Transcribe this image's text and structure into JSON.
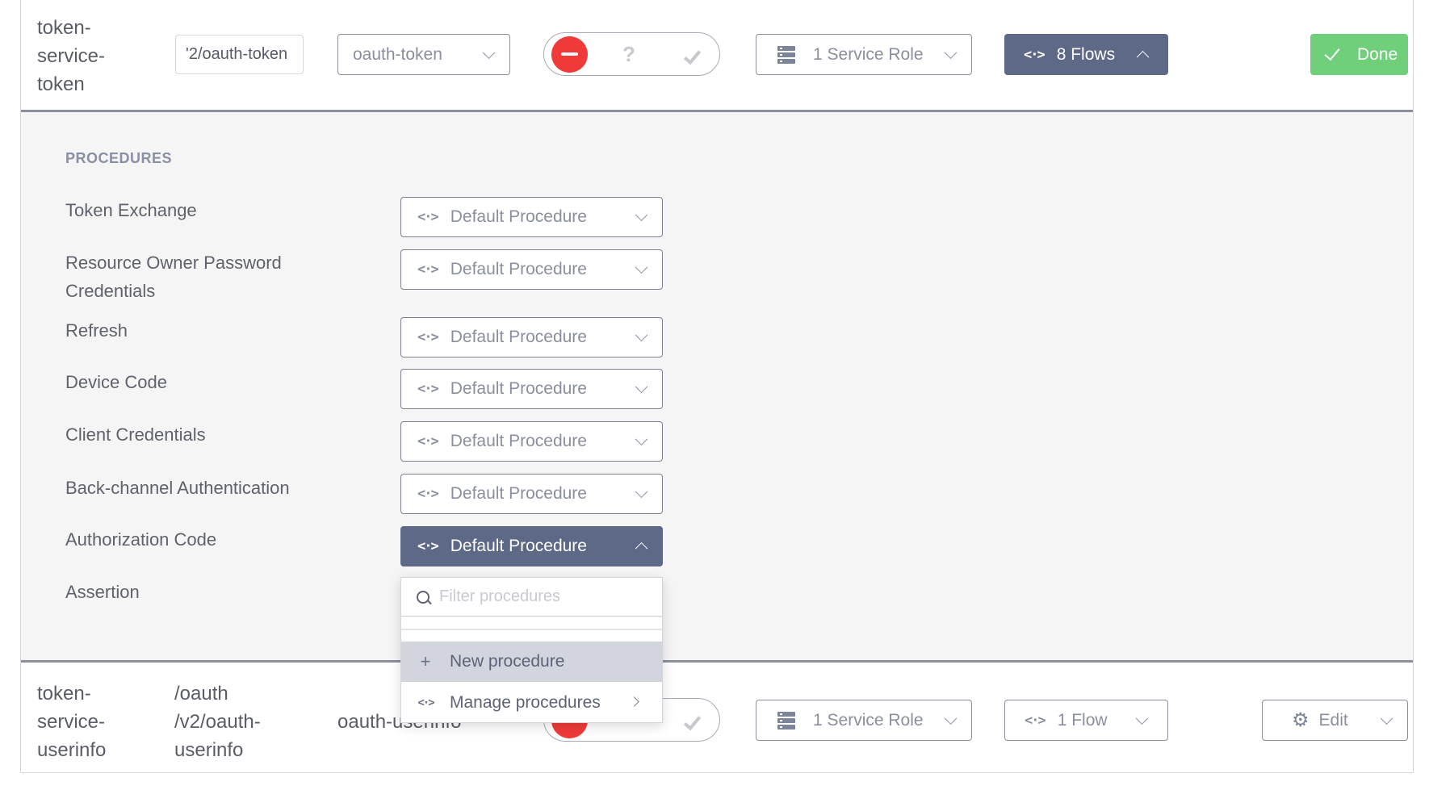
{
  "row1": {
    "name_lines": [
      "token-",
      "service-",
      "token"
    ],
    "path_value": "'2/oauth-token",
    "select_value": "oauth-token",
    "toggle": {
      "state": "deny",
      "options": [
        "deny",
        "unknown",
        "allow"
      ],
      "unknown_glyph": "?"
    },
    "service_role_label": "1 Service Role",
    "flows_label": "8 Flows",
    "flows_icon": "<·>",
    "done_label": "Done",
    "colors": {
      "accent_dark": "#5d6986",
      "done_green": "#6fcf7a",
      "deny_red": "#f03a3a"
    }
  },
  "procedures": {
    "heading": "PROCEDURES",
    "rows": [
      {
        "label_lines": [
          "Token Exchange"
        ],
        "value": "Default Procedure",
        "open": false
      },
      {
        "label_lines": [
          "Resource Owner Password",
          "Credentials"
        ],
        "value": "Default Procedure",
        "open": false
      },
      {
        "label_lines": [
          "Refresh"
        ],
        "value": "Default Procedure",
        "open": false
      },
      {
        "label_lines": [
          "Device Code"
        ],
        "value": "Default Procedure",
        "open": false
      },
      {
        "label_lines": [
          "Client Credentials"
        ],
        "value": "Default Procedure",
        "open": false
      },
      {
        "label_lines": [
          "Back-channel Authentication"
        ],
        "value": "Default Procedure",
        "open": false
      },
      {
        "label_lines": [
          "Authorization Code"
        ],
        "value": "Default Procedure",
        "open": true
      },
      {
        "label_lines": [
          "Assertion"
        ],
        "value": null,
        "open": false
      }
    ],
    "menu": {
      "filter_placeholder": "Filter procedures",
      "filter_value": "",
      "items": [
        {
          "icon": "+",
          "label": "New procedure",
          "highlighted": true
        },
        {
          "icon": "<·>",
          "label": "Manage procedures",
          "highlighted": false,
          "submenu": true
        }
      ]
    }
  },
  "row2": {
    "name_lines": [
      "token-",
      "service-",
      "userinfo"
    ],
    "path_lines": [
      "/oauth",
      "/v2/oauth-",
      "userinfo"
    ],
    "select_value": "oauth-userinfo",
    "toggle": {
      "state": "deny"
    },
    "service_role_label": "1 Service Role",
    "flows_label": "1 Flow",
    "edit_label": "Edit"
  }
}
